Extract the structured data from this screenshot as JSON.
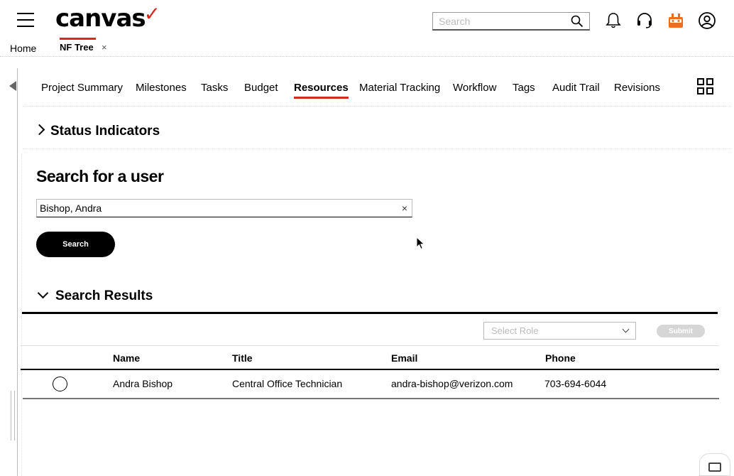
{
  "header": {
    "logo": "canvas",
    "logo_check": "✓",
    "search_placeholder": "Search"
  },
  "breadcrumbs": {
    "home": "Home",
    "active_tab": "NF Tree",
    "close": "×"
  },
  "nav": {
    "tabs": [
      {
        "label": "Project Summary"
      },
      {
        "label": "Milestones"
      },
      {
        "label": "Tasks"
      },
      {
        "label": "Budget"
      },
      {
        "label": "Resources",
        "active": true
      },
      {
        "label": "Material Tracking"
      },
      {
        "label": "Workflow"
      },
      {
        "label": "Tags"
      },
      {
        "label": "Audit Trail"
      },
      {
        "label": "Revisions"
      }
    ]
  },
  "status_indicators": {
    "title": "Status Indicators"
  },
  "user_search": {
    "title": "Search for a user",
    "input_value": "Bishop, Andra",
    "clear": "×",
    "button": "Search"
  },
  "results": {
    "title": "Search Results",
    "role_placeholder": "Select Role",
    "submit": "Submit",
    "columns": [
      "Name",
      "Title",
      "Email",
      "Phone"
    ],
    "rows": [
      {
        "name": "Andra Bishop",
        "title": "Central Office Technician",
        "email": "andra-bishop@verizon.com",
        "phone": "703-694-6044"
      }
    ]
  },
  "colors": {
    "accent": "#d52b1e",
    "icon_orange": "#ef6c1f"
  }
}
